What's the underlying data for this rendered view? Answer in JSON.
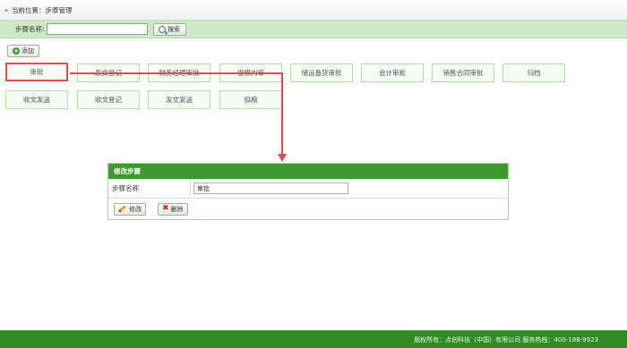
{
  "breadcrumb": {
    "label": "当前位置：步骤管理"
  },
  "search": {
    "label": "步骤名称:",
    "value": "",
    "button_label": "搜索"
  },
  "toolbar": {
    "add_label": "添加"
  },
  "steps": [
    {
      "label": "审批",
      "active": true
    },
    {
      "label": "发文登记"
    },
    {
      "label": "财务经理审批"
    },
    {
      "label": "提模内审"
    },
    {
      "label": "储运备货审批"
    },
    {
      "label": "会计审批"
    },
    {
      "label": "销售合同审批"
    },
    {
      "label": "归档"
    },
    {
      "label": "收文发送"
    },
    {
      "label": "收文登记"
    },
    {
      "label": "发文发送"
    },
    {
      "label": "拟稿"
    }
  ],
  "edit_panel": {
    "title": "修改步骤",
    "field_label": "步骤名称",
    "field_value": "审批",
    "modify_label": "修改",
    "delete_label": "删除"
  },
  "footer": {
    "text": "版权所有：点创科技（中国）有限公司 服务热线：400-188-9923"
  },
  "colors": {
    "accent": "#3d9a2e",
    "highlight": "#e64a4a",
    "search_bar": "#cde8c4"
  }
}
